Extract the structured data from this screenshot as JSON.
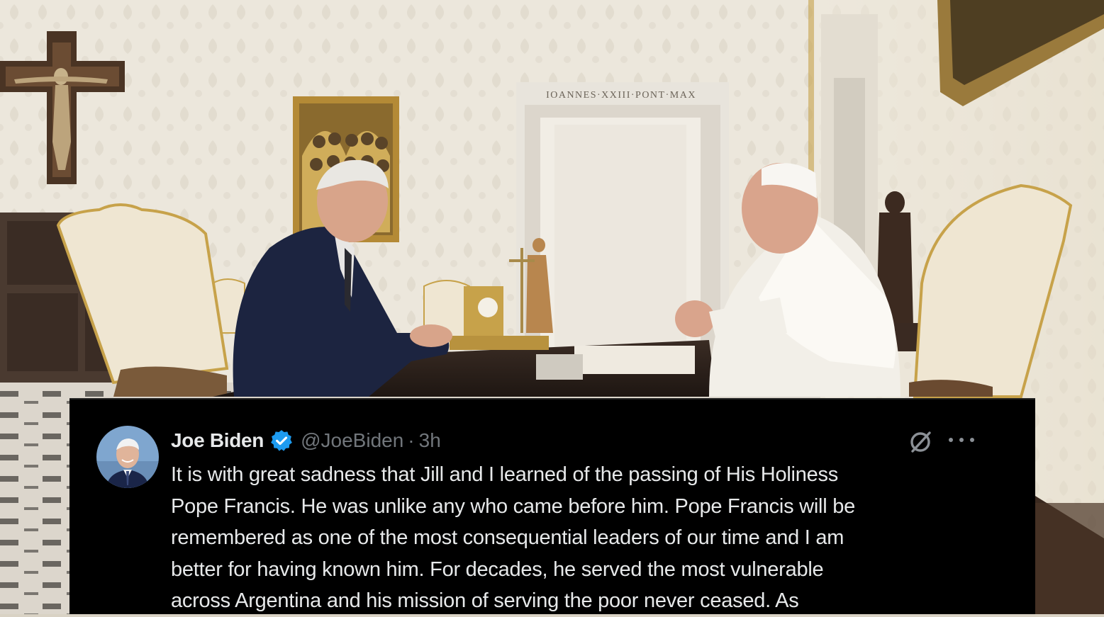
{
  "scene": {
    "door_inscription": "IOANNES·XXIII·PONT·MAX"
  },
  "tweet": {
    "author_name": "Joe Biden",
    "handle": "@JoeBiden",
    "separator": "·",
    "time": "3h",
    "lines": [
      "It is with great sadness that Jill and I learned of the passing of His Holiness",
      "Pope Francis. He was unlike any who came before him. Pope Francis will be",
      "remembered as one of the most consequential leaders of our time and I am",
      "better for having known him. For decades, he served the most vulnerable",
      "across Argentina and his mission of serving the poor never ceased. As"
    ]
  },
  "colors": {
    "card_background": "#000000",
    "text_primary": "#e7e9ea",
    "text_secondary": "#71767b",
    "verified_badge": "#1d9bf0"
  },
  "icons": [
    "verified-badge-icon",
    "grok-icon",
    "more-options-icon"
  ]
}
